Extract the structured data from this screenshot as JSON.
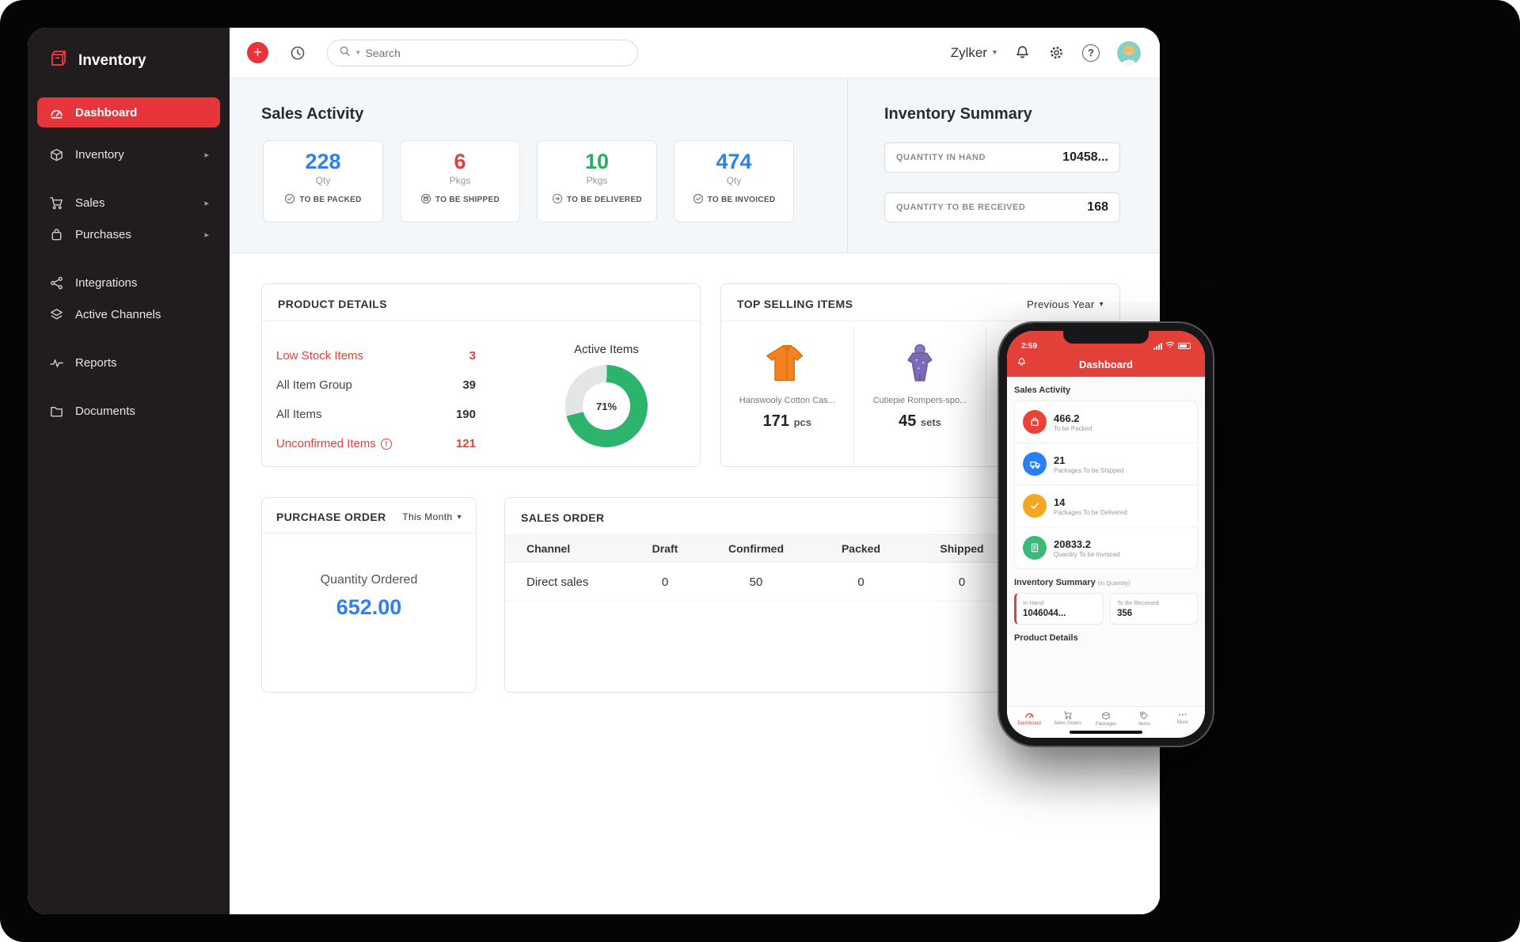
{
  "theme": {
    "accent_red": "#e8353b",
    "phone_red": "#e3403a",
    "blue": "#2f80ed",
    "green": "#27ae60",
    "donut_green": "#2cb46c"
  },
  "icons": {
    "add": "+",
    "caret_down": "▾",
    "chevron_right": "▸",
    "help": "?",
    "more": "⋯",
    "info": "!"
  },
  "sidebar": {
    "brand": "Inventory",
    "items": [
      {
        "label": "Dashboard",
        "active": true
      },
      {
        "label": "Inventory",
        "has_submenu": true
      },
      {
        "label": "Sales",
        "has_submenu": true
      },
      {
        "label": "Purchases",
        "has_submenu": true
      },
      {
        "label": "Integrations"
      },
      {
        "label": "Active Channels"
      },
      {
        "label": "Reports"
      },
      {
        "label": "Documents"
      }
    ]
  },
  "topbar": {
    "search_placeholder": "Search",
    "org": "Zylker"
  },
  "sales_activity": {
    "title": "Sales Activity",
    "cards": [
      {
        "value": "228",
        "unit": "Qty",
        "label": "TO BE PACKED",
        "color": "#2f80ed",
        "icon": "packed-check-icon"
      },
      {
        "value": "6",
        "unit": "Pkgs",
        "label": "TO BE SHIPPED",
        "color": "#e0413d",
        "icon": "shipped-box-icon"
      },
      {
        "value": "10",
        "unit": "Pkgs",
        "label": "TO BE DELIVERED",
        "color": "#27ae60",
        "icon": "delivered-arrow-icon"
      },
      {
        "value": "474",
        "unit": "Qty",
        "label": "TO BE INVOICED",
        "color": "#2f80ed",
        "icon": "invoiced-check-icon"
      }
    ]
  },
  "inventory_summary": {
    "title": "Inventory Summary",
    "rows": [
      {
        "label": "QUANTITY IN HAND",
        "value": "10458..."
      },
      {
        "label": "QUANTITY TO BE RECEIVED",
        "value": "168"
      }
    ]
  },
  "product_details": {
    "title": "PRODUCT DETAILS",
    "rows": [
      {
        "label": "Low Stock Items",
        "value": "3",
        "alert": true
      },
      {
        "label": "All Item Group",
        "value": "39"
      },
      {
        "label": "All Items",
        "value": "190"
      },
      {
        "label": "Unconfirmed Items",
        "value": "121",
        "alert": true,
        "info": true
      }
    ],
    "donut": {
      "label": "Active Items",
      "percent": 71,
      "percent_display": "71%",
      "color": "#2cb46c"
    }
  },
  "top_selling": {
    "title": "TOP SELLING ITEMS",
    "period": "Previous Year",
    "items": [
      {
        "name": "Hanswooly Cotton Cas...",
        "qty": "171",
        "unit": "pcs",
        "image": "orange-cardigan"
      },
      {
        "name": "Cutiepie Rompers-spo...",
        "qty": "45",
        "unit": "sets",
        "image": "purple-romper"
      }
    ]
  },
  "purchase_order": {
    "title": "PURCHASE ORDER",
    "period": "This Month",
    "label": "Quantity Ordered",
    "value": "652.00"
  },
  "sales_order": {
    "title": "SALES ORDER",
    "columns": [
      "Channel",
      "Draft",
      "Confirmed",
      "Packed",
      "Shipped"
    ],
    "rows": [
      {
        "channel": "Direct sales",
        "draft": "0",
        "confirmed": "50",
        "packed": "0",
        "shipped": "0"
      }
    ]
  },
  "phone": {
    "time": "2:59",
    "header": "Dashboard",
    "sales_activity_title": "Sales Activity",
    "cards": [
      {
        "value": "466.2",
        "label": "To be Packed",
        "color": "#ee4136",
        "icon": "packed-bag-icon"
      },
      {
        "value": "21",
        "label": "Packages To be Shipped",
        "color": "#2a7ff6",
        "icon": "shipped-truck-icon"
      },
      {
        "value": "14",
        "label": "Packages To be Delivered",
        "color": "#f5a623",
        "icon": "delivered-check-icon"
      },
      {
        "value": "20833.2",
        "label": "Quantity To be Invoiced",
        "color": "#3cb878",
        "icon": "invoice-doc-icon"
      }
    ],
    "inventory_summary_title": "Inventory Summary",
    "inventory_summary_suffix": "(in Quantity)",
    "summary": [
      {
        "label": "In Hand",
        "value": "1046044..."
      },
      {
        "label": "To Be Received",
        "value": "356"
      }
    ],
    "product_details_title": "Product Details",
    "nav": [
      {
        "label": "Dashboard",
        "active": true
      },
      {
        "label": "Sales Orders"
      },
      {
        "label": "Packages"
      },
      {
        "label": "Items"
      },
      {
        "label": "More"
      }
    ]
  }
}
